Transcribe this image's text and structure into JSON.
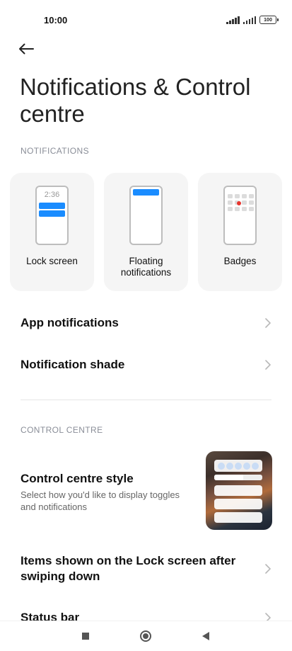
{
  "status_bar": {
    "time": "10:00",
    "battery": "100"
  },
  "page": {
    "title": "Notifications & Control centre"
  },
  "notifications_section": {
    "header": "NOTIFICATIONS",
    "cards": [
      {
        "label": "Lock screen",
        "preview_time": "2:36"
      },
      {
        "label": "Floating notifications"
      },
      {
        "label": "Badges"
      }
    ],
    "rows": [
      {
        "title": "App notifications"
      },
      {
        "title": "Notification shade"
      }
    ]
  },
  "control_centre_section": {
    "header": "CONTROL CENTRE",
    "style_row": {
      "title": "Control centre style",
      "subtitle": "Select how you'd like to display toggles and notifications"
    },
    "rows": [
      {
        "title": "Items shown on the Lock screen after swiping down"
      },
      {
        "title": "Status bar"
      }
    ]
  },
  "colors": {
    "accent_blue": "#1a8cff",
    "badge_red": "#e8352e",
    "section_header": "#8a8e98"
  },
  "icons": [
    "back-arrow-icon",
    "signal-icon",
    "battery-icon",
    "chevron-right-icon",
    "recents-icon",
    "home-icon",
    "nav-back-icon"
  ]
}
